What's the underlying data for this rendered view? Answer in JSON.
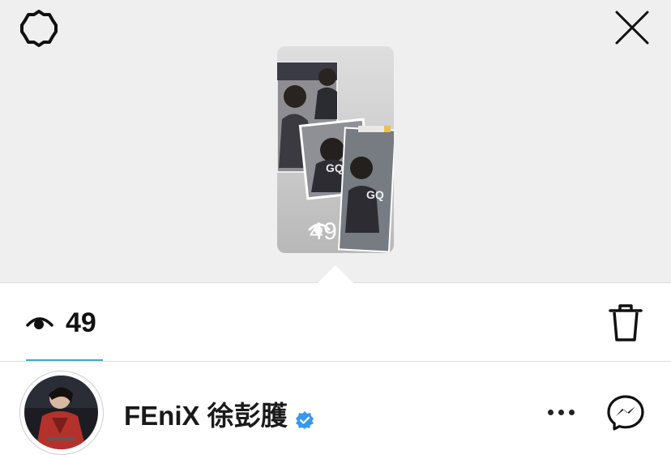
{
  "top_bar": {
    "settings_icon": "gear-icon",
    "close_icon": "close-icon"
  },
  "story_preview": {
    "view_count": "49",
    "eye_icon": "eye-icon"
  },
  "stats_bar": {
    "view_count": "49",
    "eye_icon": "eye-icon",
    "delete_icon": "trash-icon",
    "accent_color": "#4aa6c9"
  },
  "viewer": {
    "username": "FEniX 徐彭臒",
    "verified_icon": "verified-badge-icon",
    "verified_color": "#3897f0",
    "more_icon": "more-horizontal-icon",
    "message_icon": "messenger-icon"
  }
}
